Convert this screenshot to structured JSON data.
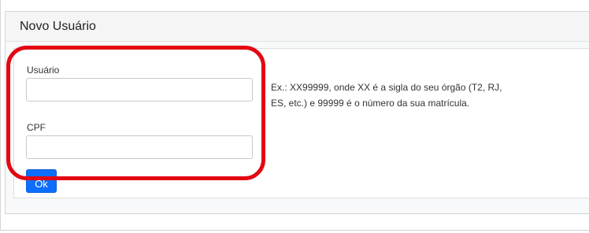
{
  "panel": {
    "title": "Novo Usuário"
  },
  "form": {
    "username_label": "Usuário",
    "username_value": "",
    "cpf_label": "CPF",
    "cpf_value": "",
    "ok_label": "Ok"
  },
  "help": {
    "text": "Ex.: XX99999, onde XX é a sigla do seu órgão (T2, RJ, ES, etc.) e 99999 é o número da sua matrícula."
  },
  "annotation": {
    "highlight_color": "#e30613"
  },
  "colors": {
    "primary_button": "#0d6efd"
  }
}
